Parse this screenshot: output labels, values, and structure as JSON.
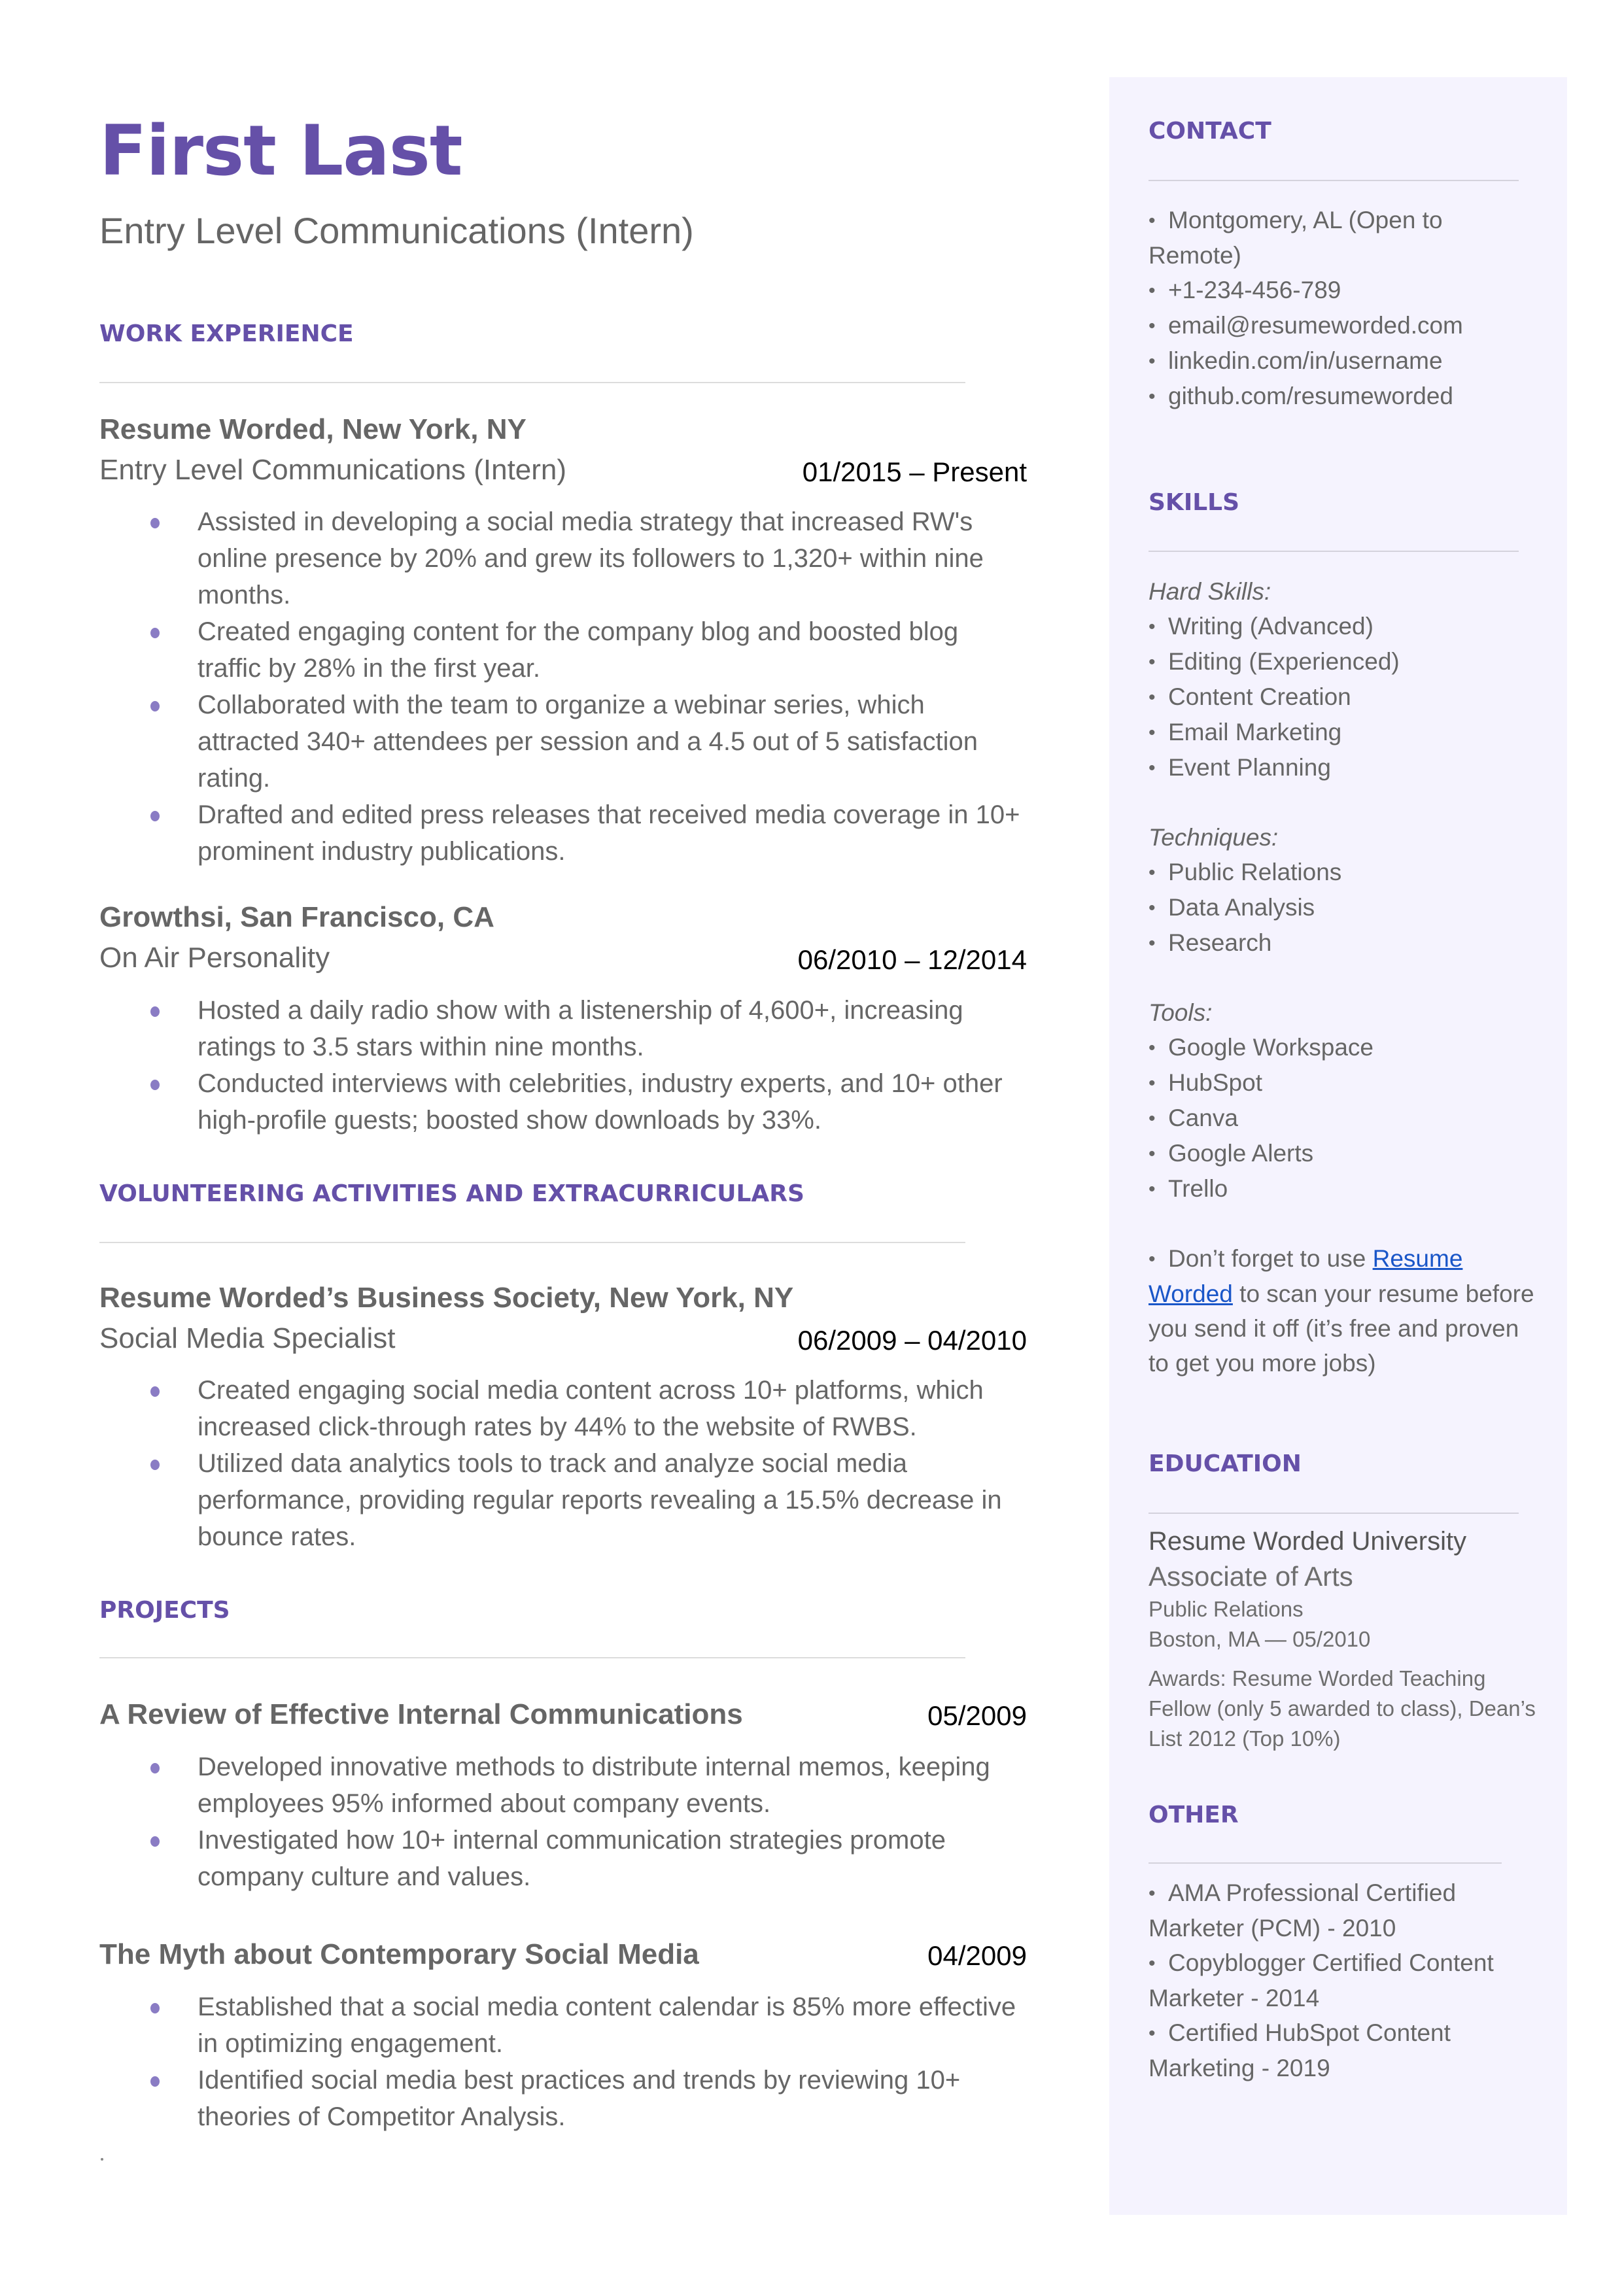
{
  "header": {
    "name": "First Last",
    "headline": "Entry Level Communications (Intern)"
  },
  "colors": {
    "accent": "#6550a8",
    "sidebar_bg": "#f5f3fe",
    "bullet": "#8a7cc4",
    "link": "#1a56c8"
  },
  "work_experience": {
    "title": "WORK EXPERIENCE",
    "jobs": [
      {
        "org": "Resume Worded, New York, NY",
        "role": "Entry Level Communications (Intern)",
        "dates": "01/2015 – Present",
        "bullets": [
          "Assisted in developing a social media strategy that increased RW's online presence by 20% and grew its followers to 1,320+ within nine months.",
          "Created engaging content for the company blog and boosted blog traffic by 28% in the first year.",
          "Collaborated with the team to organize a webinar series, which attracted 340+ attendees per session and a 4.5 out of 5 satisfaction rating.",
          "Drafted and edited press releases that received media coverage in 10+ prominent industry publications."
        ]
      },
      {
        "org": "Growthsi, San Francisco, CA",
        "role": "On Air Personality",
        "dates": "06/2010 – 12/2014",
        "bullets": [
          "Hosted a daily radio show with a listenership of 4,600+, increasing ratings to 3.5 stars within nine months.",
          "Conducted interviews with celebrities, industry experts, and 10+ other high-profile guests; boosted show downloads by 33%."
        ]
      }
    ]
  },
  "volunteering": {
    "title": "VOLUNTEERING ACTIVITIES AND EXTRACURRICULARS",
    "entries": [
      {
        "org": "Resume Worded’s Business Society, New York, NY",
        "role": "Social Media Specialist",
        "dates": "06/2009 – 04/2010",
        "bullets": [
          "Created engaging social media content across 10+ platforms, which increased click-through rates by 44% to the website of RWBS.",
          "Utilized data analytics tools to track and analyze social media performance, providing regular reports revealing a 15.5% decrease in bounce rates."
        ]
      }
    ]
  },
  "projects": {
    "title": "PROJECTS",
    "entries": [
      {
        "name": "A Review of Effective Internal Communications",
        "date": "05/2009",
        "bullets": [
          "Developed innovative methods to distribute internal memos, keeping employees 95% informed about company events.",
          "Investigated how 10+ internal communication strategies promote company culture and values."
        ]
      },
      {
        "name": "The Myth about Contemporary Social Media",
        "date": "04/2009",
        "bullets": [
          "Established that a social media content calendar is 85% more effective in optimizing engagement.",
          "Identified social media best practices and trends by reviewing 10+ theories of Competitor Analysis."
        ]
      }
    ]
  },
  "footer_mark": ".",
  "sidebar": {
    "contact": {
      "title": "CONTACT",
      "items": [
        "Montgomery, AL (Open to Remote)",
        "+1-234-456-789",
        "email@resumeworded.com",
        "linkedin.com/in/username",
        "github.com/resumeworded"
      ]
    },
    "skills": {
      "title": "SKILLS",
      "groups": [
        {
          "label": "Hard Skills:",
          "items": [
            "Writing (Advanced)",
            "Editing (Experienced)",
            "Content Creation",
            "Email Marketing",
            "Event Planning"
          ]
        },
        {
          "label": "Techniques:",
          "items": [
            "Public Relations",
            "Data Analysis",
            "Research"
          ]
        },
        {
          "label": "Tools:",
          "items": [
            "Google Workspace",
            "HubSpot",
            "Canva",
            "Google Alerts",
            "Trello"
          ]
        }
      ],
      "tip": {
        "before": "Don’t forget to use ",
        "link": "Resume Worded",
        "after": " to scan your resume before you send it off (it’s free and proven to get you more jobs)"
      }
    },
    "education": {
      "title": "EDUCATION",
      "school": "Resume Worded University",
      "degree": "Associate of Arts",
      "field": "Public Relations",
      "location_date": "Boston, MA — 05/2010",
      "awards": "Awards: Resume Worded Teaching Fellow (only 5 awarded to class), Dean’s List 2012 (Top 10%)"
    },
    "other": {
      "title": "OTHER",
      "items": [
        "AMA Professional Certified Marketer (PCM) - 2010",
        "Copyblogger Certified Content Marketer - 2014",
        "Certified HubSpot Content Marketing - 2019"
      ]
    }
  }
}
